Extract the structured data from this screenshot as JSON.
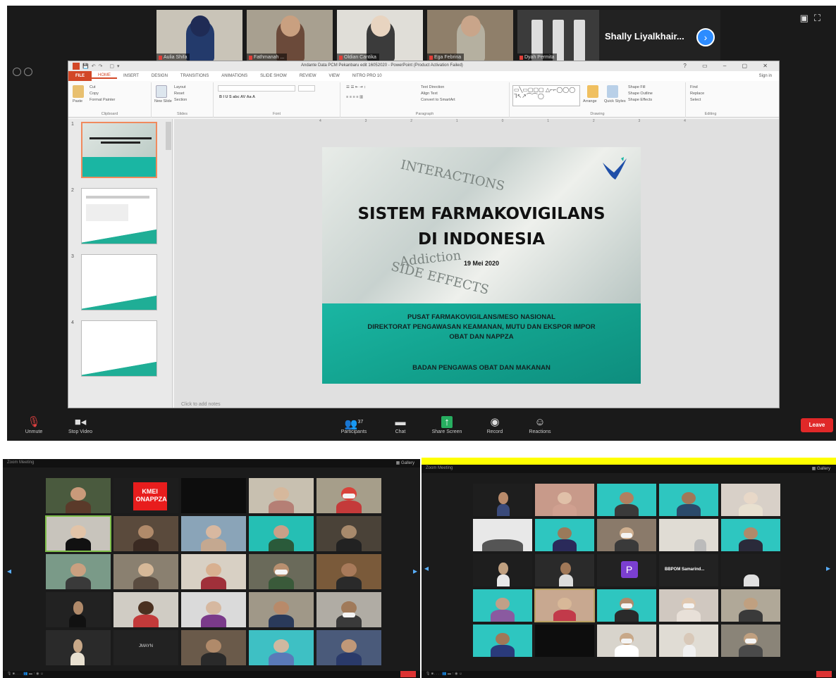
{
  "top_window": {
    "speaker_names": [
      "Aulia Shifa",
      "Fathmanah ...",
      "Oldian Cantika",
      "Ega Febrina",
      "Dyah Permita"
    ],
    "speaker_last_name": "Shally Liyalkhair...",
    "toolbar": {
      "unmute": "Unmute",
      "stop_video": "Stop Video",
      "participants": "Participants",
      "participants_count": "37",
      "chat": "Chat",
      "share_screen": "Share Screen",
      "record": "Record",
      "reactions": "Reactions",
      "leave": "Leave"
    }
  },
  "powerpoint": {
    "window_title": "Andante Data PCM Pekanbaru edit 16052020 - PowerPoint (Product Activation Failed)",
    "tabs": [
      "FILE",
      "HOME",
      "INSERT",
      "DESIGN",
      "TRANSITIONS",
      "ANIMATIONS",
      "SLIDE SHOW",
      "REVIEW",
      "VIEW",
      "NITRO PRO 10"
    ],
    "sign_in": "Sign in",
    "ribbon": {
      "clipboard": {
        "paste": "Paste",
        "cut": "Cut",
        "copy": "Copy",
        "format_painter": "Format Painter",
        "label": "Clipboard"
      },
      "slides": {
        "new_slide": "New Slide",
        "layout": "Layout",
        "reset": "Reset",
        "section": "Section",
        "label": "Slides"
      },
      "font_label": "Font",
      "paragraph": {
        "text_direction": "Text Direction",
        "align_text": "Align Text",
        "convert": "Convert to SmartArt",
        "label": "Paragraph"
      },
      "drawing": {
        "arrange": "Arrange",
        "quick_styles": "Quick Styles",
        "shape_fill": "Shape Fill",
        "shape_outline": "Shape Outline",
        "shape_effects": "Shape Effects",
        "label": "Drawing"
      },
      "editing": {
        "find": "Find",
        "replace": "Replace",
        "select": "Select",
        "label": "Editing"
      }
    },
    "slide_numbers": [
      "1",
      "2",
      "3",
      "4"
    ],
    "ruler": [
      "4",
      "3",
      "2",
      "1",
      "0",
      "1",
      "2",
      "3",
      "4"
    ],
    "notes_text": "Click to add notes",
    "slide": {
      "title_line1": "SISTEM FARMAKOVIGILANS",
      "title_line2": "DI INDONESIA",
      "date": "19 Mei 2020",
      "bg_word1": "INTERACTIONS",
      "bg_word2": "Addiction",
      "bg_word3": "SIDE EFFECTS",
      "org_line1": "PUSAT FARMAKOVIGILANS/MESO NASIONAL",
      "org_line2": "DIREKTORAT PENGAWASAN KEAMANAN, MUTU DAN EKSPOR IMPOR",
      "org_line3": "OBAT DAN NAPPZA",
      "org_line4": "BADAN PENGAWAS OBAT DAN MAKANAN"
    }
  },
  "gallery_left": {
    "title": "Zoom Meeting",
    "kmei_label": "KMEI ONAPPZA",
    "black_tile_label": "JMAYN"
  },
  "gallery_right": {
    "title": "Zoom Meeting",
    "p_letter": "P",
    "bpom_label": "BBPOM Samarind..."
  },
  "colors": {
    "ppt_accent": "#d24726",
    "zoom_blue": "#2d8cff",
    "slide_teal": "#1ab6a3",
    "leave_red": "#e02828",
    "highlight_yellow": "#ffff00"
  }
}
